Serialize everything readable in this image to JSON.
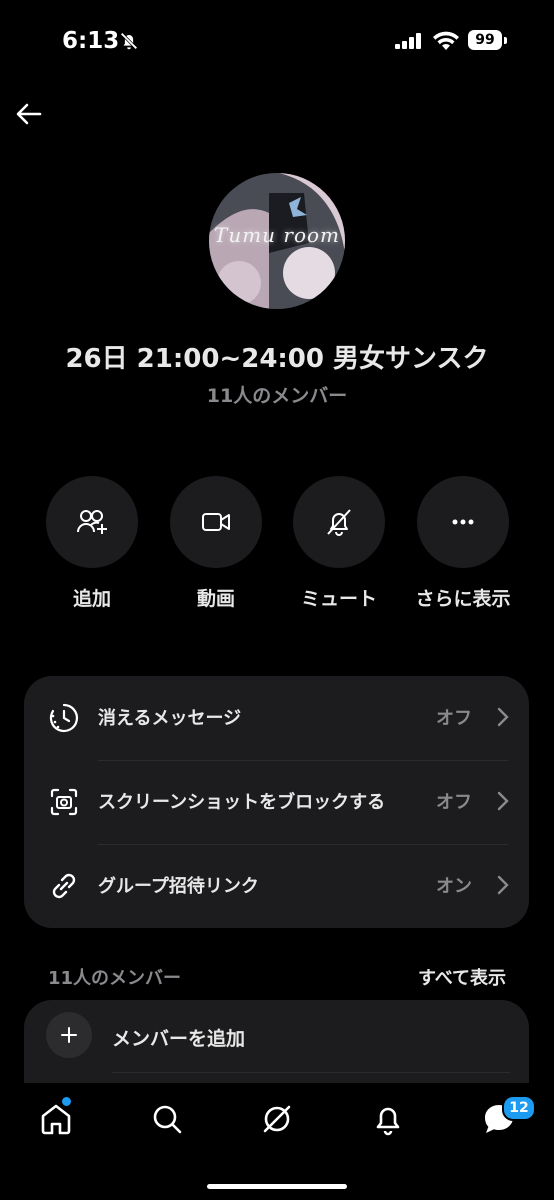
{
  "status_bar": {
    "time": "6:13",
    "battery": "99"
  },
  "group": {
    "avatar_text": "Tumu room",
    "title": "26日 21:00~24:00 男女サンスク",
    "member_count": "11人のメンバー"
  },
  "actions": [
    {
      "label": "追加",
      "icon": "add-people-icon"
    },
    {
      "label": "動画",
      "icon": "video-icon"
    },
    {
      "label": "ミュート",
      "icon": "bell-off-icon"
    },
    {
      "label": "さらに表示",
      "icon": "more-icon"
    }
  ],
  "settings": [
    {
      "label": "消えるメッセージ",
      "value": "オフ",
      "icon": "timer-icon"
    },
    {
      "label": "スクリーンショットをブロックする",
      "value": "オフ",
      "icon": "screenshot-icon"
    },
    {
      "label": "グループ招待リンク",
      "value": "オン",
      "icon": "link-icon"
    }
  ],
  "members": {
    "header": "11人のメンバー",
    "see_all": "すべて表示",
    "add_label": "メンバーを追加"
  },
  "tabbar": {
    "messages_badge": "12"
  },
  "colors": {
    "background": "#000000",
    "card": "#1c1c1e",
    "accent": "#1d9bf0",
    "muted_text": "#8a8a8e"
  }
}
